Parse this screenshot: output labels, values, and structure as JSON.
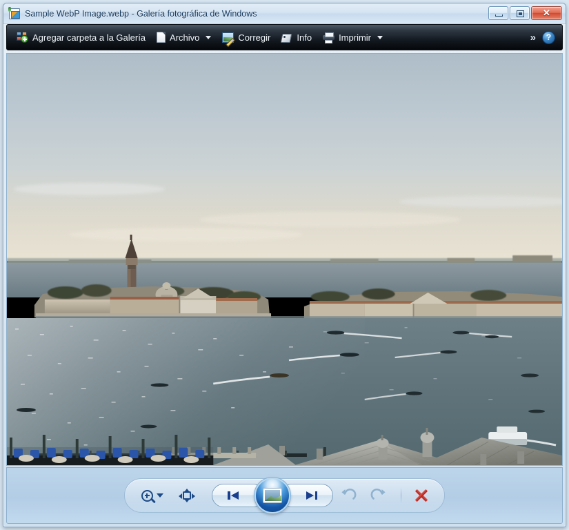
{
  "window": {
    "title": "Sample WebP Image.webp - Galería fotográfica de Windows",
    "app_icon": "photo-gallery-icon",
    "controls": {
      "minimize": "minimize-icon",
      "maximize": "maximize-icon",
      "close": "✕"
    }
  },
  "toolbar": {
    "items": [
      {
        "label": "Agregar carpeta a la Galería",
        "icon": "add-folder-gallery-icon",
        "has_caret": false
      },
      {
        "label": "Archivo",
        "icon": "file-document-icon",
        "has_caret": true
      },
      {
        "label": "Corregir",
        "icon": "fix-picture-pencil-icon",
        "has_caret": false
      },
      {
        "label": "Info",
        "icon": "info-tag-icon",
        "has_caret": false
      },
      {
        "label": "Imprimir",
        "icon": "printer-icon",
        "has_caret": true
      }
    ],
    "overflow_label": "»",
    "help_label": "?"
  },
  "photo": {
    "alt": "Vista aérea de Venecia: isla de San Giorgio Maggiore, laguna y góndolas",
    "colors": {
      "sky_top": "#b9c6cf",
      "sky_horizon": "#e3e0d6",
      "water": "#6f7f85",
      "water_dark": "#4d6168",
      "island": "#8a8374",
      "roof": "#a9aaa4",
      "gondola_blue": "#2a55a8"
    }
  },
  "controls": {
    "zoom": {
      "name": "zoom-button",
      "icon": "magnifier-plus-icon",
      "has_caret": true
    },
    "fit_window": {
      "name": "fit-to-window-button",
      "icon": "fit-to-window-icon"
    },
    "previous": {
      "name": "previous-button",
      "icon": "skip-previous-icon"
    },
    "slideshow": {
      "name": "slideshow-button",
      "icon": "slideshow-picture-icon"
    },
    "next": {
      "name": "next-button",
      "icon": "skip-next-icon"
    },
    "rotate_ccw": {
      "name": "rotate-counterclockwise-button",
      "icon": "rotate-ccw-icon",
      "enabled": false
    },
    "rotate_cw": {
      "name": "rotate-clockwise-button",
      "icon": "rotate-cw-icon",
      "enabled": false
    },
    "delete": {
      "name": "delete-button",
      "icon": "close-x-icon"
    }
  },
  "theme": {
    "accent": "#1c4a86",
    "titlebar": "#d6e4f2",
    "toolbar_dark": "#141a21",
    "panel": "#b3cde6",
    "delete_red": "#b01d16"
  }
}
